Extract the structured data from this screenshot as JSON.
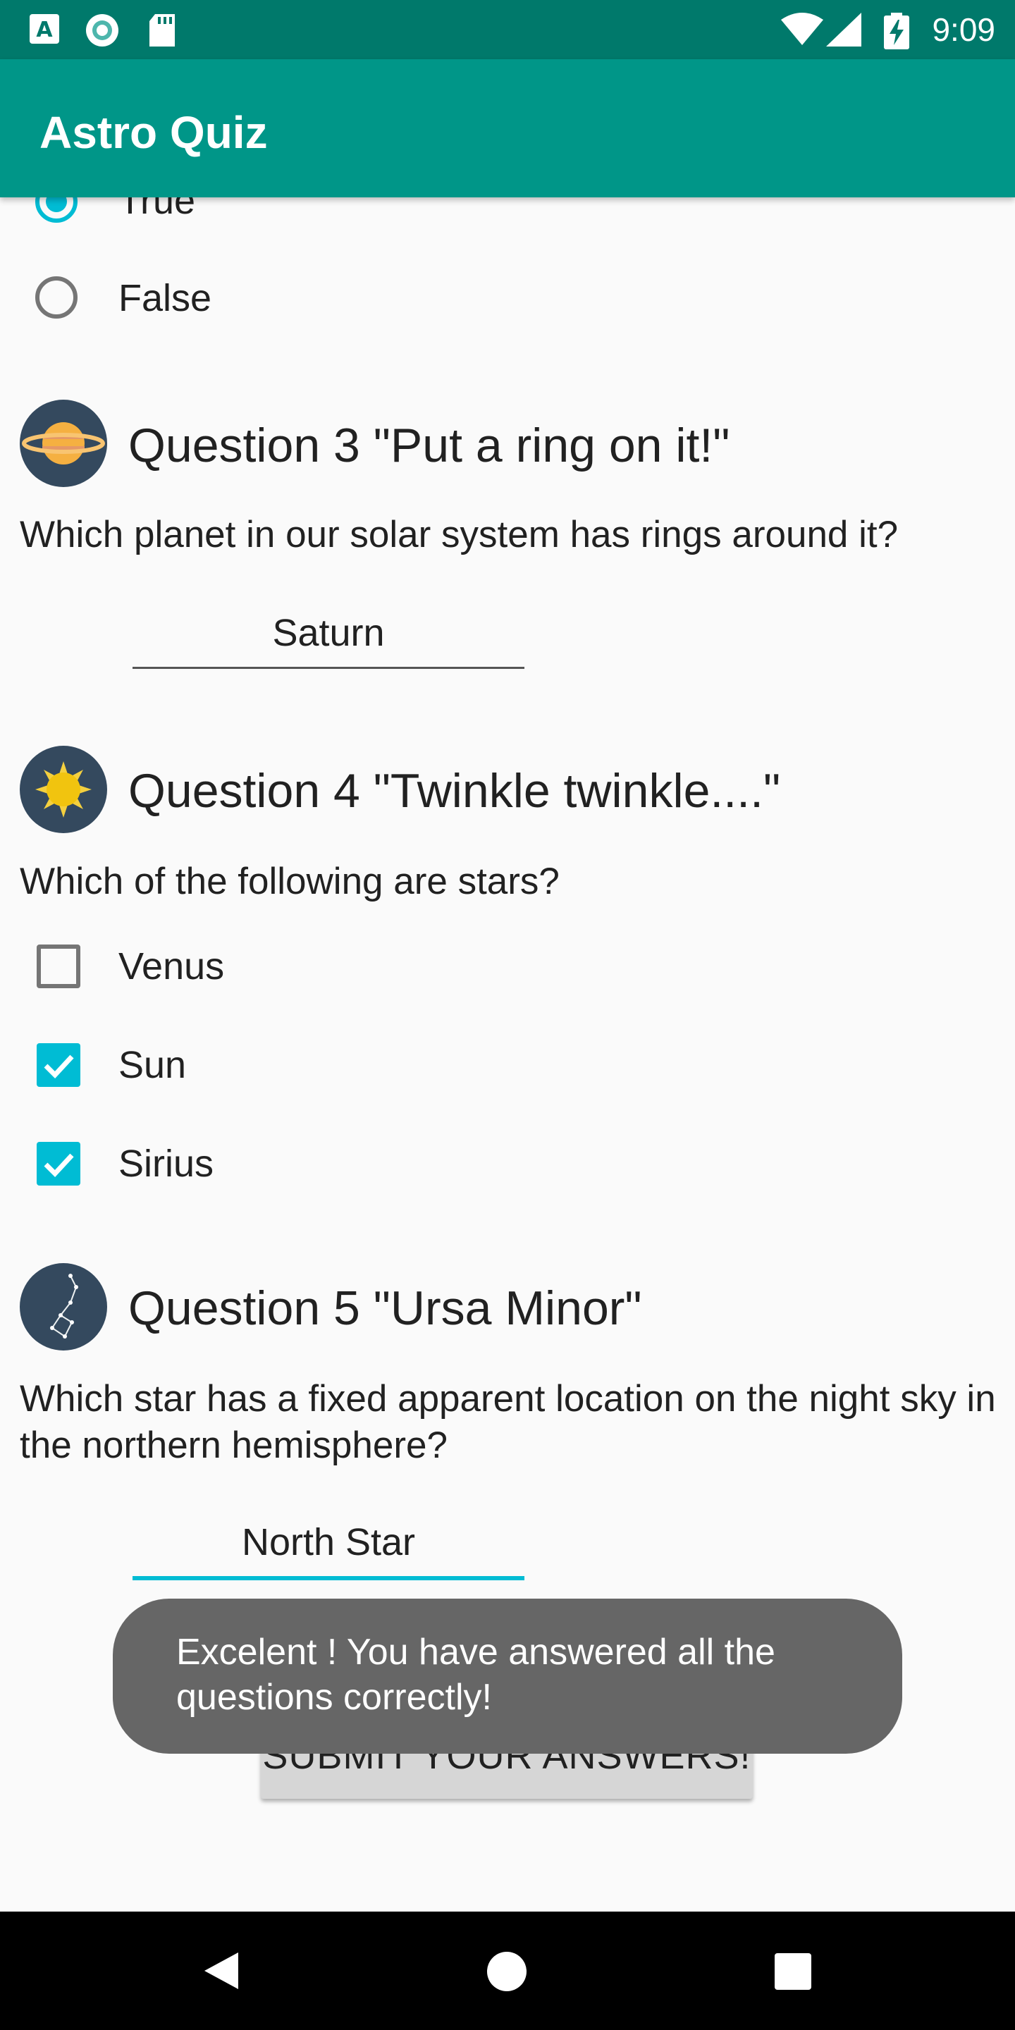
{
  "status_bar": {
    "time": "9:09",
    "icons": [
      "font-notification-icon",
      "sync-notification-icon",
      "sd-card-icon",
      "wifi-icon",
      "cellular-signal-icon",
      "battery-charging-icon"
    ]
  },
  "app_bar": {
    "title": "Astro Quiz"
  },
  "question2": {
    "options": [
      {
        "label": "True",
        "checked": true
      },
      {
        "label": "False",
        "checked": false
      }
    ]
  },
  "question3": {
    "title": "Question 3 \"Put a ring on it!\"",
    "text": "Which planet in our solar system has rings around it?",
    "answer": "Saturn",
    "icon": "saturn-icon"
  },
  "question4": {
    "title": "Question 4 \"Twinkle twinkle....\"",
    "text": "Which of the following are stars?",
    "icon": "sun-icon",
    "options": [
      {
        "label": "Venus",
        "checked": false
      },
      {
        "label": "Sun",
        "checked": true
      },
      {
        "label": "Sirius",
        "checked": true
      }
    ]
  },
  "question5": {
    "title": "Question 5 \"Ursa Minor\"",
    "text": "Which star has a fixed apparent location on the night sky in the northern hemisphere?",
    "answer": "North Star",
    "icon": "constellation-icon"
  },
  "submit": {
    "label": "SUBMIT YOUR ANSWERS!"
  },
  "toast": {
    "message": "Excelent ! You have answered all the questions correctly!"
  },
  "colors": {
    "status_bar": "#00796b",
    "app_bar": "#009688",
    "accent": "#00bcd4",
    "toast_bg": "#666666",
    "icon_circle": "#34495e"
  },
  "nav_bar": {
    "icons": [
      "back-icon",
      "home-icon",
      "recents-icon"
    ]
  }
}
